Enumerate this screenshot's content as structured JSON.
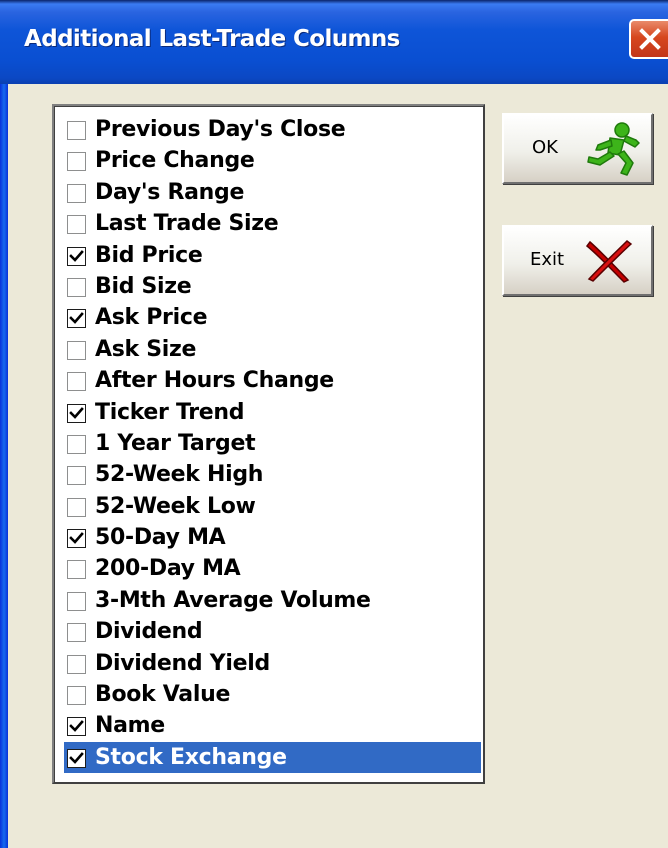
{
  "window": {
    "title": "Additional Last-Trade Columns",
    "close_icon": "close-x-icon"
  },
  "columns": [
    {
      "label": "Previous Day's Close",
      "checked": false,
      "selected": false
    },
    {
      "label": "Price Change",
      "checked": false,
      "selected": false
    },
    {
      "label": "Day's Range",
      "checked": false,
      "selected": false
    },
    {
      "label": "Last Trade Size",
      "checked": false,
      "selected": false
    },
    {
      "label": "Bid Price",
      "checked": true,
      "selected": false
    },
    {
      "label": "Bid Size",
      "checked": false,
      "selected": false
    },
    {
      "label": "Ask Price",
      "checked": true,
      "selected": false
    },
    {
      "label": "Ask Size",
      "checked": false,
      "selected": false
    },
    {
      "label": "After Hours Change",
      "checked": false,
      "selected": false
    },
    {
      "label": "Ticker Trend",
      "checked": true,
      "selected": false
    },
    {
      "label": "1 Year Target",
      "checked": false,
      "selected": false
    },
    {
      "label": "52-Week High",
      "checked": false,
      "selected": false
    },
    {
      "label": "52-Week Low",
      "checked": false,
      "selected": false
    },
    {
      "label": "50-Day MA",
      "checked": true,
      "selected": false
    },
    {
      "label": "200-Day MA",
      "checked": false,
      "selected": false
    },
    {
      "label": "3-Mth Average Volume",
      "checked": false,
      "selected": false
    },
    {
      "label": "Dividend",
      "checked": false,
      "selected": false
    },
    {
      "label": "Dividend Yield",
      "checked": false,
      "selected": false
    },
    {
      "label": "Book Value",
      "checked": false,
      "selected": false
    },
    {
      "label": "Name",
      "checked": true,
      "selected": false
    },
    {
      "label": "Stock Exchange",
      "checked": true,
      "selected": true
    }
  ],
  "buttons": {
    "ok": {
      "label": "OK",
      "icon": "running-man-icon"
    },
    "exit": {
      "label": "Exit",
      "icon": "red-x-icon"
    }
  },
  "colors": {
    "titlebar": "#0a4fd2",
    "selection": "#316ac5",
    "dialog_bg": "#ece9d8",
    "ok_icon": "#3db41a",
    "exit_icon": "#c40000"
  }
}
